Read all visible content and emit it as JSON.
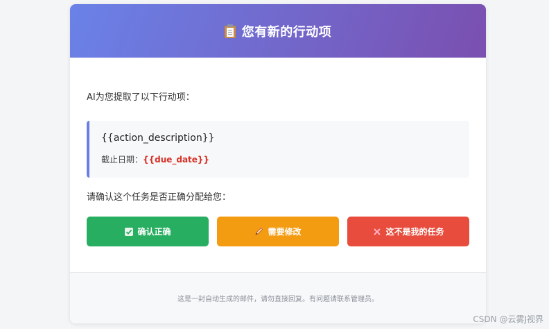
{
  "header": {
    "icon": "clipboard-icon",
    "title": "您有新的行动项"
  },
  "intro_text": "AI为您提取了以下行动项：",
  "action": {
    "description": "{{action_description}}",
    "due_label": "截止日期：",
    "due_value": "{{due_date}}"
  },
  "confirm_text": "请确认这个任务是否正确分配给您：",
  "buttons": [
    {
      "label": "确认正确",
      "icon": "check-box-icon",
      "color": "#27ae60"
    },
    {
      "label": "需要修改",
      "icon": "pencil-icon",
      "color": "#f39c12"
    },
    {
      "label": "这不是我的任务",
      "icon": "cross-icon",
      "color": "#e74c3c"
    }
  ],
  "footer_text": "这是一封自动生成的邮件，请勿直接回复。有问题请联系管理员。",
  "watermark": "CSDN @云雾J视界",
  "colors": {
    "header_gradient_start": "#6a82e8",
    "header_gradient_end": "#7a4fb0",
    "accent_border": "#6a7de4",
    "due_date": "#d93025"
  }
}
